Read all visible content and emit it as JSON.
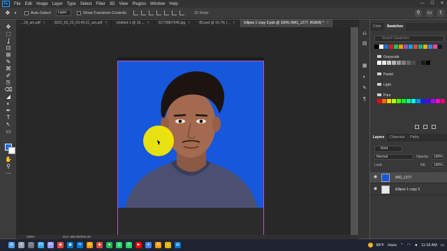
{
  "app": {
    "logo": "Ps",
    "menu": [
      "File",
      "Edit",
      "Image",
      "Layer",
      "Type",
      "Select",
      "Filter",
      "3D",
      "View",
      "Plugins",
      "Window",
      "Help"
    ]
  },
  "window_controls": [
    "—",
    "☐",
    "✕"
  ],
  "options_bar": {
    "auto_select_label": "Auto-Select:",
    "auto_select_value": "Layer",
    "show_transform_label": "Show Transform Controls",
    "mode_3d_label": "3D Mode:"
  },
  "tabs": [
    {
      "label": "...18_am.pdf",
      "active": false
    },
    {
      "label": "2022_03_23_03-45-21_am.pdf",
      "active": false
    },
    {
      "label": "Untitled-1 @ 16....",
      "active": false
    },
    {
      "label": "01778807649.jpg",
      "active": false
    },
    {
      "label": "80.psd @ 16.7% (...",
      "active": false
    },
    {
      "label": "Ellipse 1 copy 3.psb @ 100% (IMG_1277, RGB/8) *",
      "active": true
    }
  ],
  "tools": [
    "✥",
    "⬚",
    "ʆ",
    "⊡",
    "⊠",
    "✎",
    "⌘",
    "✐",
    "⎘",
    "⌫",
    "◢",
    "◐",
    "✒",
    "T",
    "↖",
    "▭",
    "✋",
    "⚲",
    "⋯"
  ],
  "colors": {
    "foreground": "#1e6fd9",
    "background": "#ffffff",
    "photo_bg": "#1757dc",
    "artboard_border": "#c254c2",
    "cursor_highlight": "#f8ee00"
  },
  "swatches_panel": {
    "tabs": [
      "Color",
      "Swatches"
    ],
    "active_tab": "Swatches",
    "search_placeholder": "Search Swatches",
    "recent": [
      "#000000",
      "#ffffff",
      "#1e6fd9",
      "#e11d1d",
      "#22c55e",
      "#f59e0b",
      "#9b59b6",
      "#0ea5e9",
      "#ef4444",
      "#10b981",
      "#eab308",
      "#3b82f6",
      "#ec4899",
      "#111827"
    ],
    "folders": [
      {
        "name": "Grayscale",
        "colors": [
          "#ffffff",
          "#e6e6e6",
          "#cccccc",
          "#b3b3b3",
          "#999999",
          "#808080",
          "#666666",
          "#4d4d4d",
          "#333333",
          "#1a1a1a",
          "#000000"
        ]
      },
      {
        "name": "Pastel",
        "colors": []
      },
      {
        "name": "Light",
        "colors": []
      },
      {
        "name": "Pure",
        "colors": [
          "#ff0000",
          "#ff6a00",
          "#ffd800",
          "#b6ff00",
          "#4cff00",
          "#00ff21",
          "#00ff90",
          "#00ffff",
          "#0094ff",
          "#0026ff",
          "#4800ff",
          "#b200ff",
          "#ff00dc",
          "#ff006e"
        ]
      }
    ]
  },
  "layers_panel": {
    "tabs": [
      "Layers",
      "Channels",
      "Paths"
    ],
    "active_tab": "Layers",
    "filter_value": "Kind",
    "blend_mode": "Normal",
    "opacity_label": "Opacity:",
    "opacity_value": "100%",
    "lock_label": "Lock:",
    "fill_label": "Fill:",
    "fill_value": "100%",
    "layers": [
      {
        "name": "IMG_1277",
        "selected": true,
        "visible": true,
        "type": "photo"
      },
      {
        "name": "Ellipse 1 copy 3",
        "selected": false,
        "visible": true,
        "type": "shape"
      }
    ]
  },
  "status_bar": {
    "zoom": "100%",
    "doc_info": "Doc: 582.8K/903.2K"
  },
  "taskbar": {
    "apps": [
      "⊞",
      "⚲",
      "▢",
      "Ps",
      "Pr",
      "◉",
      "▣",
      "✉",
      "Ai",
      "◆",
      "◈",
      "◎",
      "✆",
      "▶",
      "●",
      "Ai",
      "◐",
      "▤"
    ],
    "app_colors": [
      "#4aa3ff",
      "#9aa3b5",
      "#6b7280",
      "#31a8ff",
      "#9999ff",
      "#e2483d",
      "#0078d4",
      "#0078d4",
      "#ff9a00",
      "#dd4b39",
      "#1db954",
      "#25d366",
      "#25d366",
      "#ff0000",
      "#4285f4",
      "#ff9a00",
      "#eab308",
      "#0078d4"
    ],
    "weather": "88°F",
    "weather_desc": "Haze",
    "time": "11:18 AM",
    "date": "5/25/2022"
  }
}
